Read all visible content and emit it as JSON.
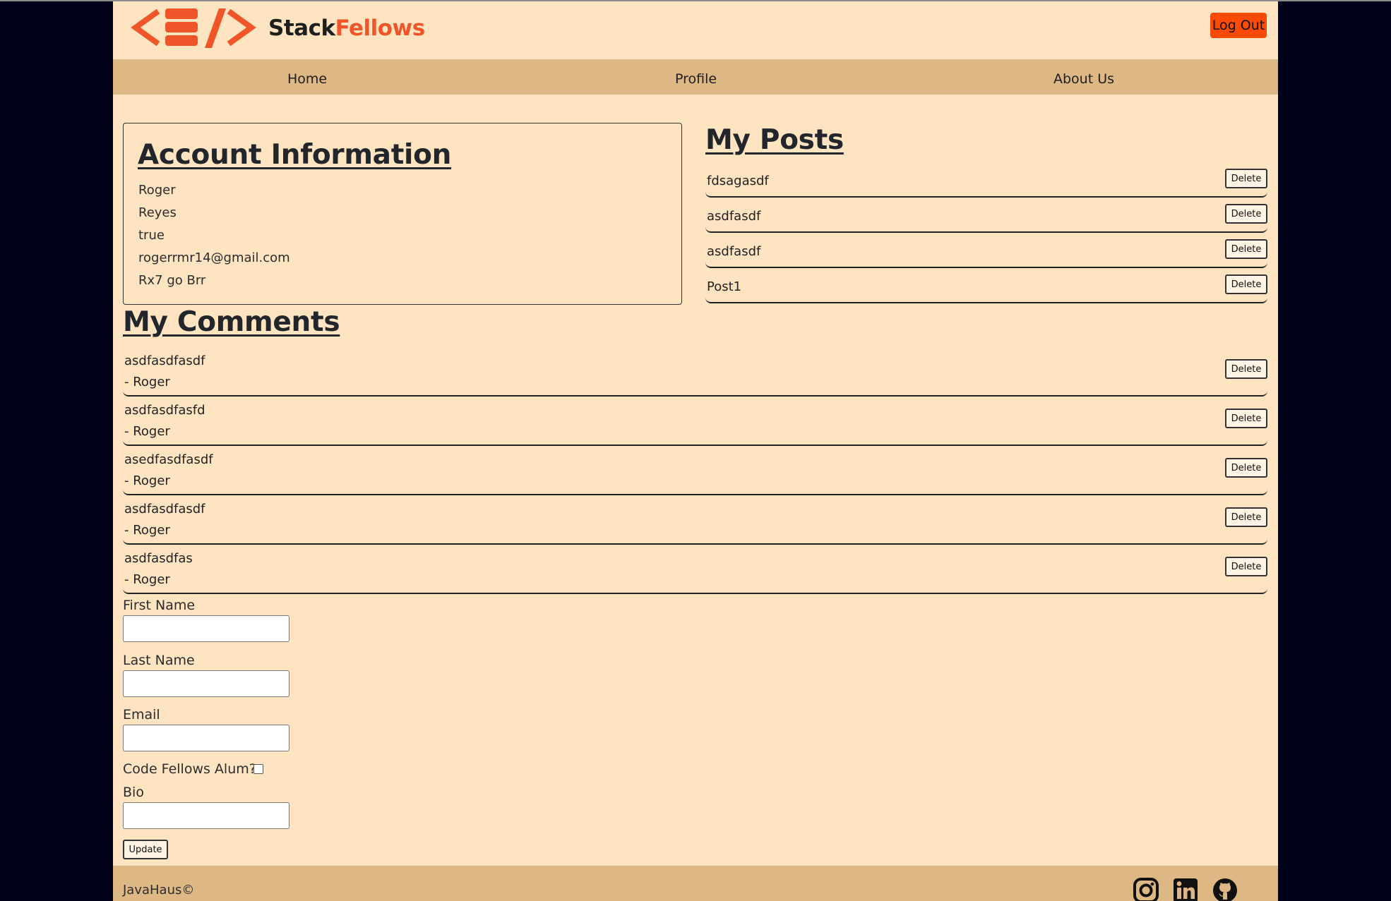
{
  "header": {
    "brand_part1": "Stack",
    "brand_part2": "Fellows",
    "logout_label": "Log Out"
  },
  "nav": {
    "items": [
      "Home",
      "Profile",
      "About Us"
    ]
  },
  "account": {
    "title": "Account Information",
    "first_name": "Roger",
    "last_name": "Reyes",
    "alum": "true",
    "email": "rogerrmr14@gmail.com",
    "bio": "Rx7 go Brr"
  },
  "posts": {
    "title": "My Posts",
    "items": [
      {
        "text": "fdsagasdf",
        "delete_label": "Delete"
      },
      {
        "text": "asdfasdf",
        "delete_label": "Delete"
      },
      {
        "text": "asdfasdf",
        "delete_label": "Delete"
      },
      {
        "text": "Post1",
        "delete_label": "Delete"
      }
    ]
  },
  "comments": {
    "title": "My Comments",
    "items": [
      {
        "text": "asdfasdfasdf",
        "author": "- Roger",
        "delete_label": "Delete"
      },
      {
        "text": "asdfasdfasfd",
        "author": "- Roger",
        "delete_label": "Delete"
      },
      {
        "text": "asedfasdfasdf",
        "author": "- Roger",
        "delete_label": "Delete"
      },
      {
        "text": "asdfasdfasdf",
        "author": "- Roger",
        "delete_label": "Delete"
      },
      {
        "text": "asdfasdfas",
        "author": "- Roger",
        "delete_label": "Delete"
      }
    ]
  },
  "form": {
    "first_name_label": "First Name",
    "first_name_value": "",
    "last_name_label": "Last Name",
    "last_name_value": "",
    "email_label": "Email",
    "email_value": "",
    "alum_label": "Code Fellows Alum?",
    "alum_checked": false,
    "bio_label": "Bio",
    "bio_value": "",
    "update_label": "Update"
  },
  "footer": {
    "copyright": "JavaHaus©",
    "social_icons": [
      "instagram-icon",
      "linkedin-icon",
      "github-icon"
    ]
  },
  "colors": {
    "page_bg": "#ffe4c2",
    "nav_bg": "#ddb885",
    "accent": "#ef5528",
    "logout_bg": "#fb4a07",
    "outer_bg": "#01021a"
  }
}
